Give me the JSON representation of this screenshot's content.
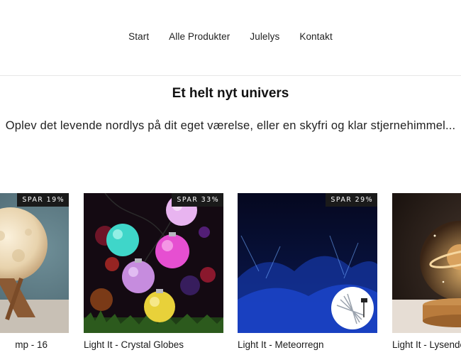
{
  "nav": {
    "items": [
      {
        "label": "Start"
      },
      {
        "label": "Alle Produkter"
      },
      {
        "label": "Julelys"
      },
      {
        "label": "Kontakt"
      }
    ]
  },
  "hero": {
    "title": "Et helt nyt univers",
    "subtitle": "Oplev det levende nordlys på dit eget værelse, eller en skyfri og klar stjernehimmel..."
  },
  "products": [
    {
      "title": "mp - 16",
      "badge": "SPAR 19%"
    },
    {
      "title": "Light It - Crystal Globes",
      "badge": "SPAR 33%"
    },
    {
      "title": "Light It - Meteorregn",
      "badge": "SPAR 29%"
    },
    {
      "title": "Light It - Lysende",
      "badge": ""
    }
  ]
}
